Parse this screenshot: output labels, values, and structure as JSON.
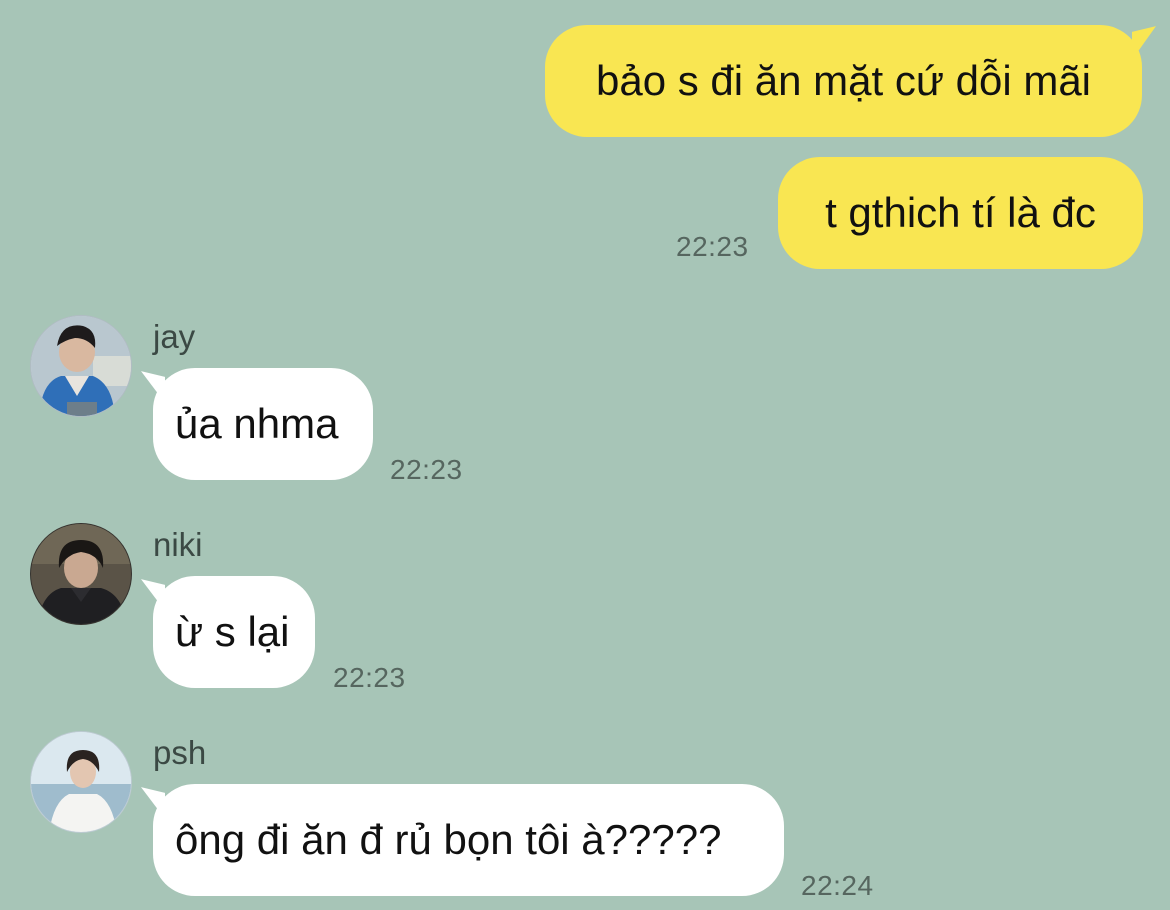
{
  "messages": [
    {
      "direction": "out",
      "text": "bảo s đi ăn mặt cứ dỗi mãi"
    },
    {
      "direction": "out",
      "text": "t gthich tí là đc",
      "time": "22:23"
    },
    {
      "direction": "in",
      "sender": "jay",
      "text": "ủa nhma",
      "time": "22:23"
    },
    {
      "direction": "in",
      "sender": "niki",
      "text": "ừ s lại",
      "time": "22:23"
    },
    {
      "direction": "in",
      "sender": "psh",
      "text": "ông đi ăn đ rủ bọn tôi à?????",
      "time": "22:24"
    }
  ],
  "colors": {
    "background": "#a7c5b7",
    "outgoing_bubble": "#f9e652",
    "incoming_bubble": "#ffffff",
    "timestamp": "#56665f",
    "sender_name": "#3b4944"
  },
  "icons": {
    "avatar_jay": "profile-photo",
    "avatar_niki": "profile-photo",
    "avatar_psh": "profile-photo"
  }
}
